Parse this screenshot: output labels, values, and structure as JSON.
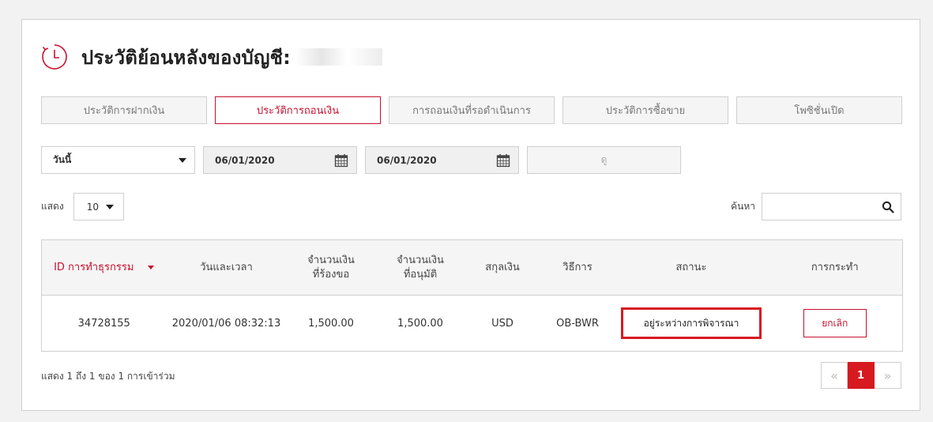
{
  "colors": {
    "accent": "#c8102e",
    "highlight_border": "#d71920"
  },
  "header": {
    "title": "ประวัติย้อนหลังของบัญชี:"
  },
  "tabs": [
    {
      "label": "ประวัติการฝากเงิน",
      "active": false
    },
    {
      "label": "ประวัติการถอนเงิน",
      "active": true
    },
    {
      "label": "การถอนเงินที่รอดำเนินการ",
      "active": false
    },
    {
      "label": "ประวัติการซื้อขาย",
      "active": false
    },
    {
      "label": "โพซิชั่นเปิด",
      "active": false
    }
  ],
  "filters": {
    "period_selected": "วันนี้",
    "date_from": "06/01/2020",
    "date_to": "06/01/2020",
    "view_label": "ดู"
  },
  "controls": {
    "show_label": "แสดง",
    "page_size": "10",
    "search_label": "ค้นหา",
    "search_value": ""
  },
  "table": {
    "headers": {
      "id": "ID การทำธุรกรรม",
      "datetime": "วันและเวลา",
      "requested_l1": "จำนวนเงิน",
      "requested_l2": "ที่ร้องขอ",
      "approved_l1": "จำนวนเงิน",
      "approved_l2": "ที่อนุมัติ",
      "currency": "สกุลเงิน",
      "method": "วิธีการ",
      "status": "สถานะ",
      "action": "การกระทำ"
    },
    "rows": [
      {
        "id": "34728155",
        "datetime": "2020/01/06 08:32:13",
        "requested": "1,500.00",
        "approved": "1,500.00",
        "currency": "USD",
        "method": "OB-BWR",
        "status": "อยู่ระหว่างการพิจารณา",
        "action": "ยกเลิก"
      }
    ]
  },
  "footer": {
    "info": "แสดง 1 ถึง 1 ของ 1 การเข้าร่วม",
    "pager_prev": "«",
    "pager_current": "1",
    "pager_next": "»"
  }
}
